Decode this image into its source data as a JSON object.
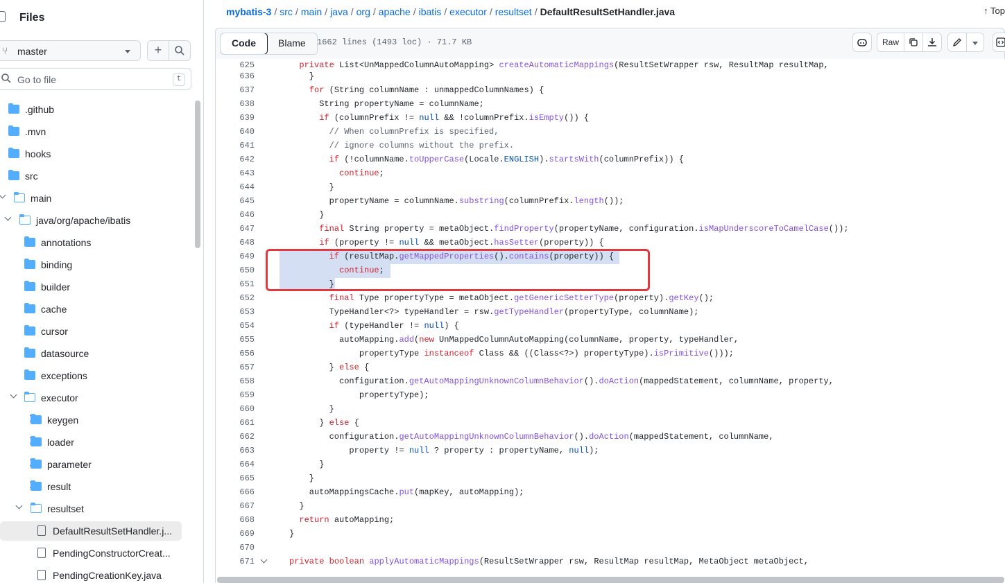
{
  "sidebar": {
    "title": "Files",
    "branch": "master",
    "go_to_file": "Go to file",
    "go_to_shortcut": "t",
    "tree": [
      {
        "label": ".github",
        "indent": 0,
        "kind": "folder",
        "state": "none"
      },
      {
        "label": ".mvn",
        "indent": 0,
        "kind": "folder",
        "state": "none"
      },
      {
        "label": "hooks",
        "indent": 0,
        "kind": "folder",
        "state": "none"
      },
      {
        "label": "src",
        "indent": 0,
        "kind": "folder",
        "state": "none"
      },
      {
        "label": "main",
        "indent": 1,
        "kind": "folder",
        "state": "open"
      },
      {
        "label": "java/org/apache/ibatis",
        "indent": 2,
        "kind": "folder",
        "state": "open"
      },
      {
        "label": "annotations",
        "indent": 3,
        "kind": "folder",
        "state": "closed"
      },
      {
        "label": "binding",
        "indent": 3,
        "kind": "folder",
        "state": "closed"
      },
      {
        "label": "builder",
        "indent": 3,
        "kind": "folder",
        "state": "closed"
      },
      {
        "label": "cache",
        "indent": 3,
        "kind": "folder",
        "state": "closed"
      },
      {
        "label": "cursor",
        "indent": 3,
        "kind": "folder",
        "state": "closed"
      },
      {
        "label": "datasource",
        "indent": 3,
        "kind": "folder",
        "state": "closed"
      },
      {
        "label": "exceptions",
        "indent": 3,
        "kind": "folder",
        "state": "closed"
      },
      {
        "label": "executor",
        "indent": 3,
        "kind": "folder",
        "state": "open"
      },
      {
        "label": "keygen",
        "indent": 4,
        "kind": "folder",
        "state": "closed"
      },
      {
        "label": "loader",
        "indent": 4,
        "kind": "folder",
        "state": "closed"
      },
      {
        "label": "parameter",
        "indent": 4,
        "kind": "folder",
        "state": "closed"
      },
      {
        "label": "result",
        "indent": 4,
        "kind": "folder",
        "state": "closed"
      },
      {
        "label": "resultset",
        "indent": 4,
        "kind": "folder",
        "state": "open"
      },
      {
        "label": "DefaultResultSetHandler.j...",
        "indent": 5,
        "kind": "file",
        "state": "selected"
      },
      {
        "label": "PendingConstructorCreat...",
        "indent": 5,
        "kind": "file",
        "state": "none"
      },
      {
        "label": "PendingCreationKey.java",
        "indent": 5,
        "kind": "file",
        "state": "none"
      }
    ]
  },
  "breadcrumb": {
    "repo": "mybatis-3",
    "parts": [
      "src",
      "main",
      "java",
      "org",
      "apache",
      "ibatis",
      "executor",
      "resultset"
    ],
    "current": "DefaultResultSetHandler.java"
  },
  "top_link": "Top",
  "file_header": {
    "code_tab": "Code",
    "blame_tab": "Blame",
    "info": "1662 lines (1493 loc) · 71.7 KB",
    "raw_label": "Raw"
  },
  "code": {
    "lines": [
      {
        "n": "625",
        "fold": false,
        "html": "  <span class='k'>private</span> List&lt;UnMappedColumnAutoMapping&gt; <span class='f'>createAutomaticMappings</span>(ResultSetWrapper rsw, ResultMap resultMap,"
      },
      {
        "n": "636",
        "fold": false,
        "html": "    }"
      },
      {
        "n": "637",
        "fold": false,
        "html": "    <span class='k'>for</span> (String columnName : unmappedColumnNames) {"
      },
      {
        "n": "638",
        "fold": false,
        "html": "      String propertyName = columnName;"
      },
      {
        "n": "639",
        "fold": false,
        "html": "      <span class='k'>if</span> (columnPrefix != <span class='n'>null</span> &amp;&amp; !columnPrefix.<span class='f'>isEmpty</span>()) {"
      },
      {
        "n": "640",
        "fold": false,
        "html": "        <span class='c'>// When columnPrefix is specified,</span>"
      },
      {
        "n": "641",
        "fold": false,
        "html": "        <span class='c'>// ignore columns without the prefix.</span>"
      },
      {
        "n": "642",
        "fold": false,
        "html": "        <span class='k'>if</span> (!columnName.<span class='f'>toUpperCase</span>(Locale.<span class='n'>ENGLISH</span>).<span class='f'>startsWith</span>(columnPrefix)) {"
      },
      {
        "n": "643",
        "fold": false,
        "html": "          <span class='k'>continue</span>;"
      },
      {
        "n": "644",
        "fold": false,
        "html": "        }"
      },
      {
        "n": "645",
        "fold": false,
        "html": "        propertyName = columnName.<span class='f'>substring</span>(columnPrefix.<span class='f'>length</span>());"
      },
      {
        "n": "646",
        "fold": false,
        "html": "      }"
      },
      {
        "n": "647",
        "fold": false,
        "html": "      <span class='k'>final</span> String property = metaObject.<span class='f'>findProperty</span>(propertyName, configuration.<span class='f'>isMapUnderscoreToCamelCase</span>());"
      },
      {
        "n": "648",
        "fold": false,
        "html": "      <span class='k'>if</span> (property != <span class='n'>null</span> &amp;&amp; metaObject.<span class='f'>hasSetter</span>(property)) {"
      },
      {
        "n": "649",
        "fold": false,
        "html": "        <span class='k'>if</span> (resultMap.<span class='f'>getMappedProperties</span>().<span class='f'>contains</span>(property)) {"
      },
      {
        "n": "650",
        "fold": false,
        "html": "          <span class='k'>continue</span>;"
      },
      {
        "n": "651",
        "fold": false,
        "html": "        }"
      },
      {
        "n": "652",
        "fold": false,
        "html": "        <span class='k'>final</span> Type propertyType = metaObject.<span class='f'>getGenericSetterType</span>(property).<span class='f'>getKey</span>();"
      },
      {
        "n": "653",
        "fold": false,
        "html": "        TypeHandler&lt;?&gt; typeHandler = rsw.<span class='f'>getTypeHandler</span>(propertyType, columnName);"
      },
      {
        "n": "654",
        "fold": false,
        "html": "        <span class='k'>if</span> (typeHandler != <span class='n'>null</span>) {"
      },
      {
        "n": "655",
        "fold": false,
        "html": "          autoMapping.<span class='f'>add</span>(<span class='k'>new</span> UnMappedColumnAutoMapping(columnName, property, typeHandler,"
      },
      {
        "n": "656",
        "fold": false,
        "html": "              propertyType <span class='k'>instanceof</span> Class &amp;&amp; ((Class&lt;?&gt;) propertyType).<span class='f'>isPrimitive</span>()));"
      },
      {
        "n": "657",
        "fold": false,
        "html": "        } <span class='k'>else</span> {"
      },
      {
        "n": "658",
        "fold": false,
        "html": "          configuration.<span class='f'>getAutoMappingUnknownColumnBehavior</span>().<span class='f'>doAction</span>(mappedStatement, columnName, property,"
      },
      {
        "n": "659",
        "fold": false,
        "html": "              propertyType);"
      },
      {
        "n": "660",
        "fold": false,
        "html": "        }"
      },
      {
        "n": "661",
        "fold": false,
        "html": "      } <span class='k'>else</span> {"
      },
      {
        "n": "662",
        "fold": false,
        "html": "        configuration.<span class='f'>getAutoMappingUnknownColumnBehavior</span>().<span class='f'>doAction</span>(mappedStatement, columnName,"
      },
      {
        "n": "663",
        "fold": false,
        "html": "            property != <span class='n'>null</span> ? property : propertyName, <span class='n'>null</span>);"
      },
      {
        "n": "664",
        "fold": false,
        "html": "      }"
      },
      {
        "n": "665",
        "fold": false,
        "html": "    }"
      },
      {
        "n": "666",
        "fold": false,
        "html": "    autoMappingsCache.<span class='f'>put</span>(mapKey, autoMapping);"
      },
      {
        "n": "667",
        "fold": false,
        "html": "  }"
      },
      {
        "n": "668",
        "fold": false,
        "html": "  <span class='k'>return</span> autoMapping;"
      },
      {
        "n": "669",
        "fold": false,
        "html": "}"
      },
      {
        "n": "670",
        "fold": false,
        "html": ""
      },
      {
        "n": "671",
        "fold": true,
        "html": "<span class='k'>private</span> <span class='k'>boolean</span> <span class='f'>applyAutomaticMappings</span>(ResultSetWrapper rsw, ResultMap resultMap, MetaObject metaObject,"
      }
    ]
  }
}
